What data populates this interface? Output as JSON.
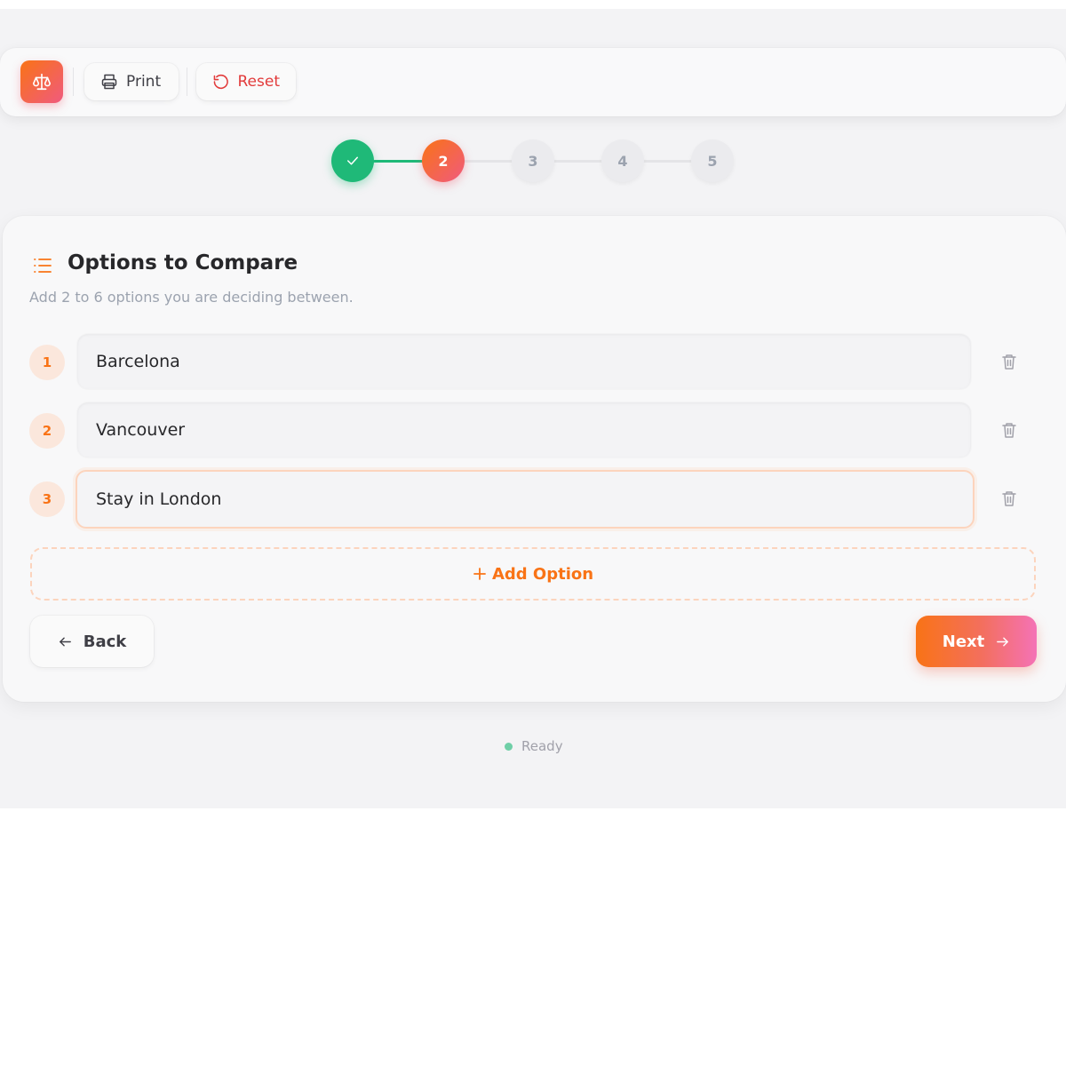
{
  "toolbar": {
    "logo_icon": "scale-icon",
    "print_label": "Print",
    "reset_label": "Reset"
  },
  "stepper": {
    "steps": [
      {
        "label": "",
        "state": "done"
      },
      {
        "label": "2",
        "state": "current"
      },
      {
        "label": "3",
        "state": "pending"
      },
      {
        "label": "4",
        "state": "pending"
      },
      {
        "label": "5",
        "state": "pending"
      }
    ]
  },
  "card": {
    "title": "Options to Compare",
    "subtitle": "Add 2 to 6 options you are deciding between.",
    "options": [
      {
        "number": "1",
        "value": "Barcelona"
      },
      {
        "number": "2",
        "value": "Vancouver"
      },
      {
        "number": "3",
        "value": "Stay in London"
      }
    ],
    "add_option_label": "Add Option",
    "back_label": "Back",
    "next_label": "Next"
  },
  "status": {
    "text": "Ready"
  },
  "colors": {
    "accent": "#f97316",
    "accent_pink": "#f05a7e",
    "success": "#1fb978",
    "danger": "#e23b3b"
  }
}
